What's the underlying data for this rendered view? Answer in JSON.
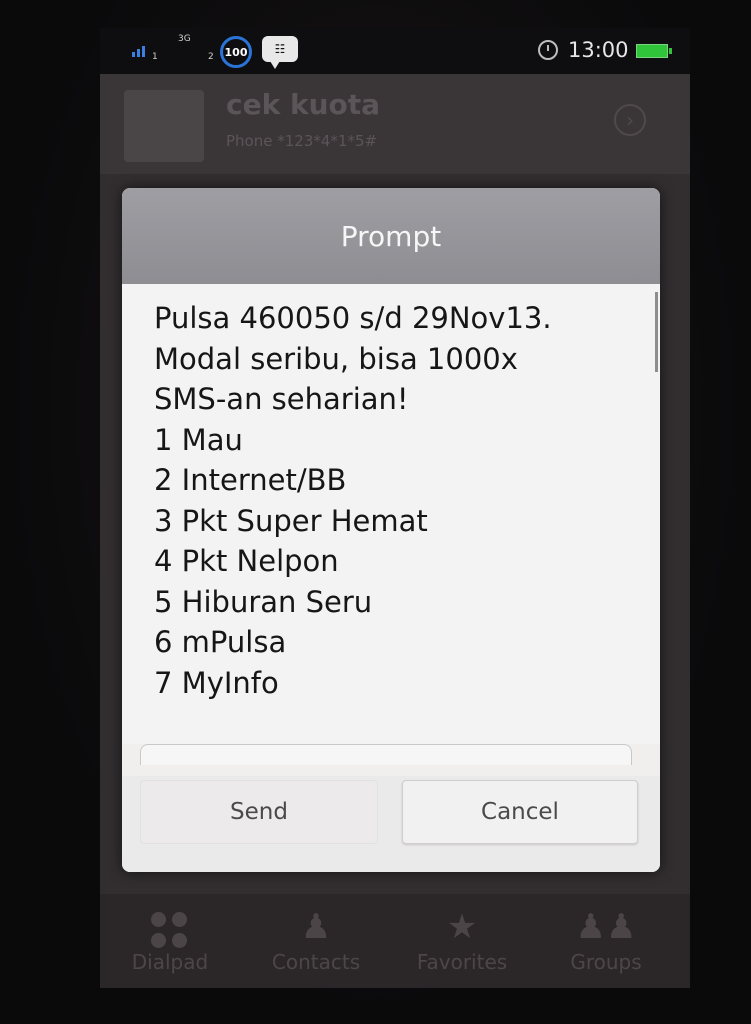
{
  "status_bar": {
    "network": "3G",
    "sim1": "1",
    "sim2": "2",
    "badge_count": "100",
    "bbm_icon": "bbm-icon",
    "time": "13:00",
    "battery_color": "#2fc43a"
  },
  "contact": {
    "name": "cek kuota",
    "phone": "Phone  *123*4*1*5#"
  },
  "dialog": {
    "title": "Prompt",
    "lines": [
      "Pulsa 460050 s/d 29Nov13.",
      "Modal seribu, bisa 1000x",
      "SMS-an seharian!",
      "1 Mau",
      "2 Internet/BB",
      "3 Pkt Super Hemat",
      "4 Pkt Nelpon",
      "5 Hiburan Seru",
      "6 mPulsa",
      "7 MyInfo"
    ],
    "reply_value": "",
    "send_label": "Send",
    "cancel_label": "Cancel"
  },
  "tabs": [
    {
      "label": "Dialpad",
      "icon": "dialpad-icon"
    },
    {
      "label": "Contacts",
      "icon": "contacts-icon"
    },
    {
      "label": "Favorites",
      "icon": "favorites-icon"
    },
    {
      "label": "Groups",
      "icon": "groups-icon"
    }
  ]
}
